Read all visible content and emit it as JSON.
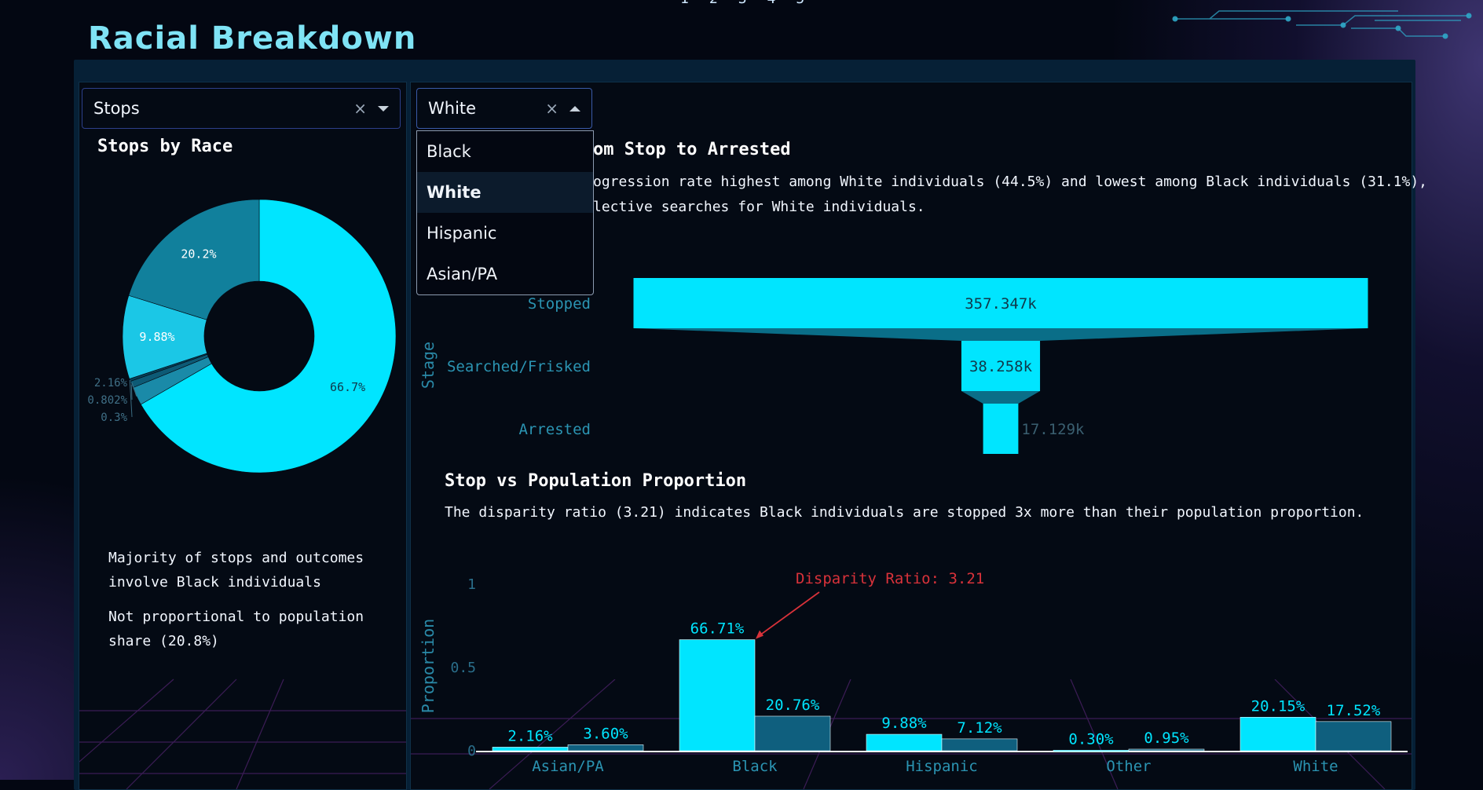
{
  "pager": [
    "1",
    "2",
    "3",
    "4",
    "5"
  ],
  "page_title": "Racial Breakdown",
  "metric_dropdown": {
    "value": "Stops"
  },
  "race_dropdown": {
    "value": "White",
    "options": [
      "Black",
      "White",
      "Hispanic",
      "Asian/PA"
    ],
    "selected": "White"
  },
  "left": {
    "title": "Stops by Race",
    "notes": [
      "Majority of stops and outcomes involve Black individuals",
      "Not proportional to population share (20.8%)"
    ]
  },
  "funnel_section": {
    "title": "om Stop to Arrested",
    "desc_line1": "ogression rate highest among White individuals (44.5%) and lowest among Black individuals (31.1%),",
    "desc_line2": "lective searches for White individuals."
  },
  "proportion_section": {
    "title": "Stop vs Population Proportion",
    "desc": "The disparity ratio (3.21) indicates Black individuals are stopped 3x more than their population proportion."
  },
  "colors": {
    "accent": "#00e5ff",
    "dark_series": "#0f5f7e",
    "annotation": "#d9323a"
  },
  "chart_data": [
    {
      "type": "pie",
      "hole": true,
      "slices": [
        {
          "label": "66.7%",
          "value": 66.7,
          "color": "#00e5ff"
        },
        {
          "label": "2.16%",
          "value": 2.16,
          "color": "#1a8aa8"
        },
        {
          "label": "0.802%",
          "value": 0.802,
          "color": "#0d5a75"
        },
        {
          "label": "0.3%",
          "value": 0.3,
          "color": "#074057"
        },
        {
          "label": "9.88%",
          "value": 9.88,
          "color": "#1bc7e6"
        },
        {
          "label": "20.2%",
          "value": 20.2,
          "color": "#11809c"
        }
      ]
    },
    {
      "type": "funnel",
      "ylabel": "Stage",
      "stages": [
        "Stopped",
        "Searched/Frisked",
        "Arrested"
      ],
      "values": [
        357347,
        38258,
        17129
      ],
      "labels": [
        "357.347k",
        "38.258k",
        "17.129k"
      ]
    },
    {
      "type": "bar",
      "ylabel": "Proportion",
      "ylim": [
        0,
        1
      ],
      "yticks": [
        "0",
        "0.5",
        "1"
      ],
      "categories": [
        "Asian/PA",
        "Black",
        "Hispanic",
        "Other",
        "White"
      ],
      "series": [
        {
          "values": [
            0.0216,
            0.6671,
            0.0988,
            0.003,
            0.2015
          ],
          "labels": [
            "2.16%",
            "66.71%",
            "9.88%",
            "0.30%",
            "20.15%"
          ],
          "color": "#00e5ff"
        },
        {
          "values": [
            0.036,
            0.2076,
            0.0712,
            0.0095,
            0.1752
          ],
          "labels": [
            "3.60%",
            "20.76%",
            "7.12%",
            "0.95%",
            "17.52%"
          ],
          "color": "#0f5f7e"
        }
      ],
      "annotation": "Disparity Ratio: 3.21"
    }
  ]
}
